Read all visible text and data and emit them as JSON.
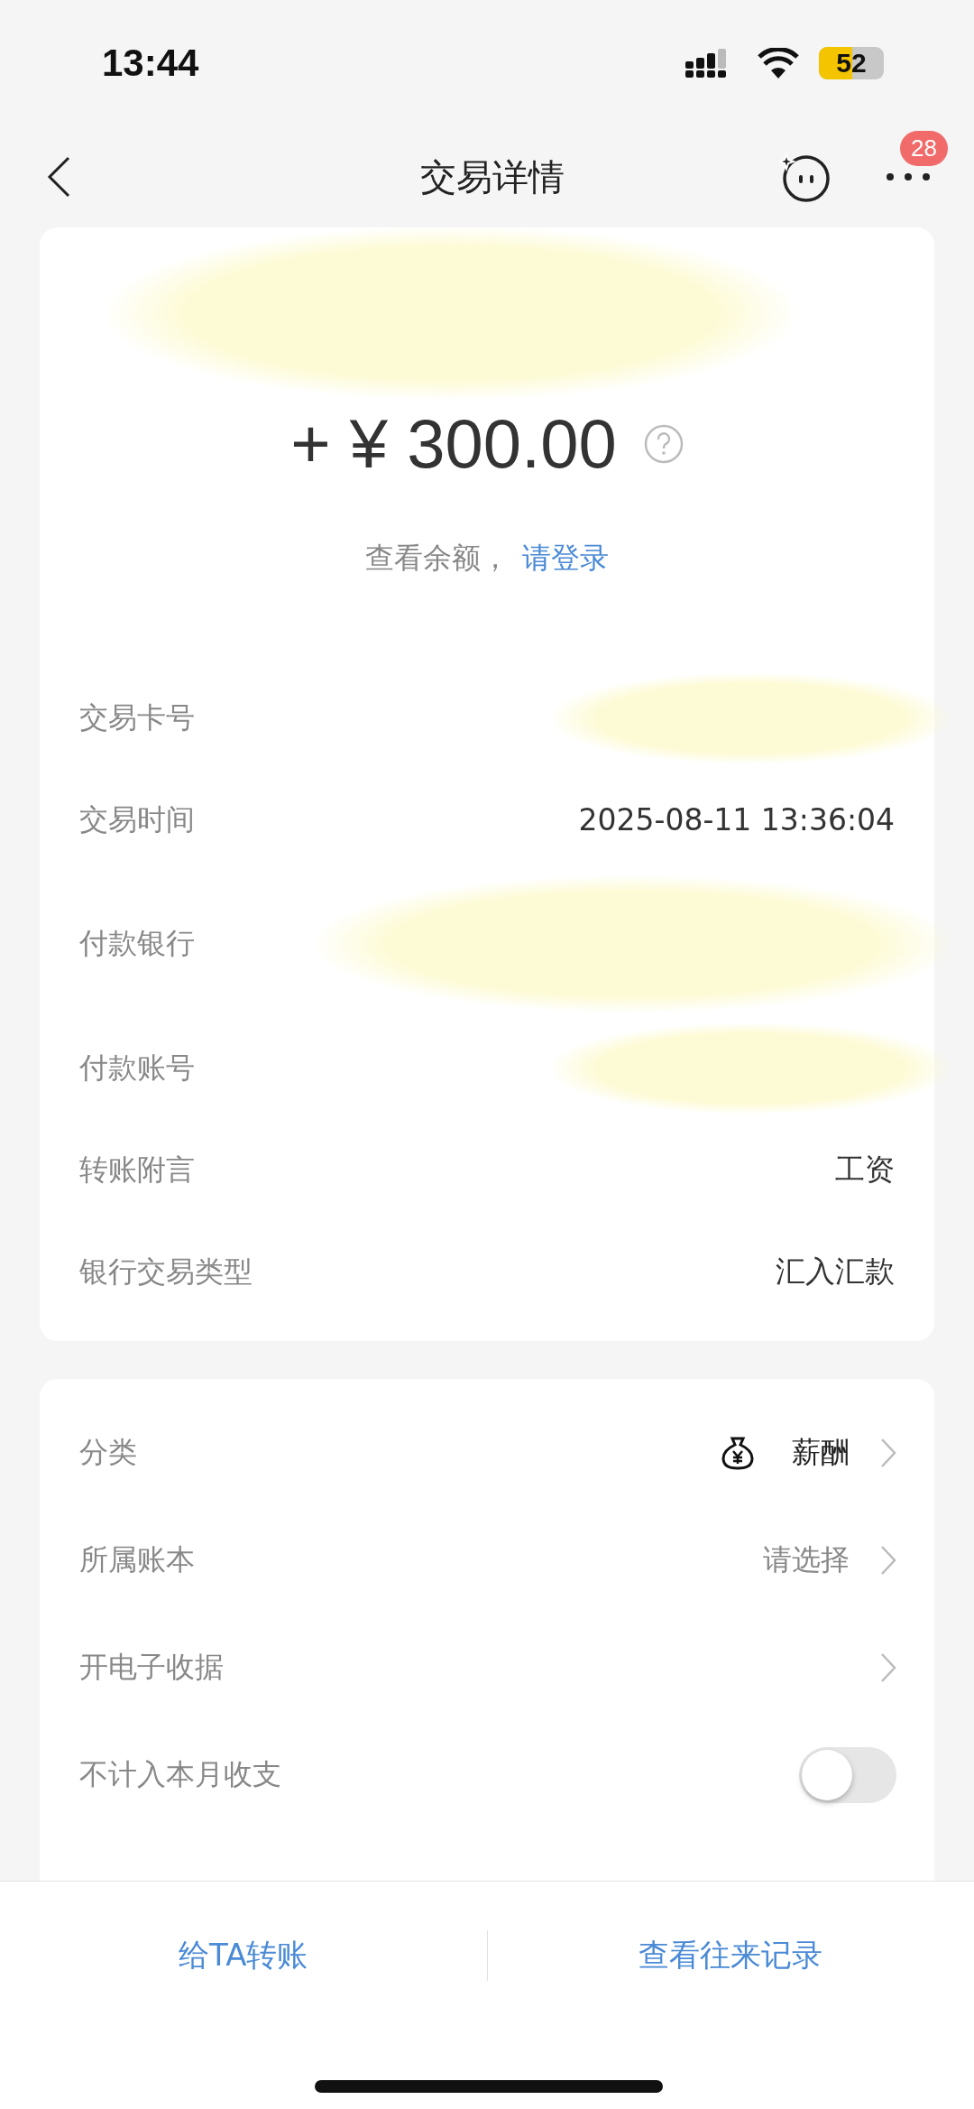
{
  "status_bar": {
    "time": "13:44",
    "battery": "52"
  },
  "header": {
    "title": "交易详情",
    "badge": "28"
  },
  "summary": {
    "amount": "+ ¥ 300.00",
    "balance_text": "查看余额，",
    "login_link": "请登录"
  },
  "details": [
    {
      "label": "交易卡号",
      "kind": "redacted-line"
    },
    {
      "label": "交易时间",
      "kind": "text",
      "value": "2025-08-11 13:36:04"
    },
    {
      "label": "付款银行",
      "kind": "redacted-block"
    },
    {
      "label": "付款账号",
      "kind": "redacted-line"
    },
    {
      "label": "转账附言",
      "kind": "text",
      "value": "工资"
    },
    {
      "label": "银行交易类型",
      "kind": "text",
      "value": "汇入汇款"
    }
  ],
  "settings": [
    {
      "label": "分类",
      "kind": "link",
      "value": "薪酬",
      "has_icon": true
    },
    {
      "label": "所属账本",
      "kind": "link",
      "prompt": "请选择"
    },
    {
      "label": "开电子收据",
      "kind": "link"
    },
    {
      "label": "不计入本月收支",
      "kind": "toggle",
      "on": false
    }
  ],
  "actions": [
    "给TA转账",
    "查看往来记录"
  ]
}
